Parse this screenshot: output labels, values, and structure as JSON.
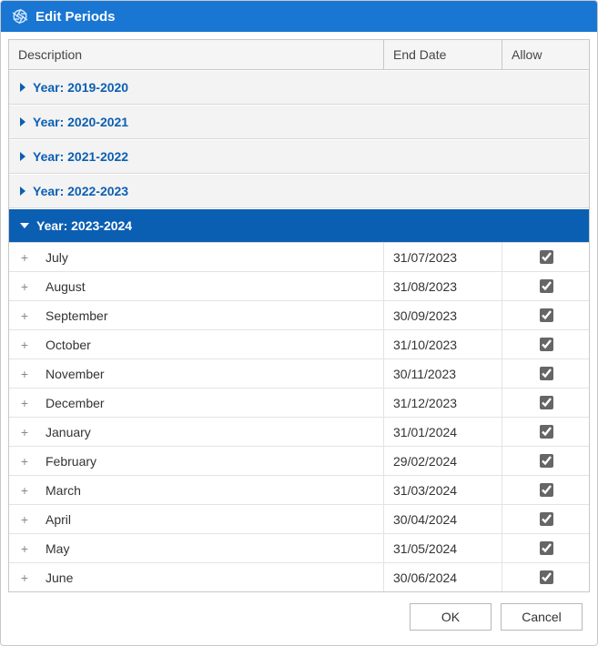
{
  "title": "Edit Periods",
  "columns": {
    "description": "Description",
    "end_date": "End Date",
    "allow": "Allow"
  },
  "groups": [
    {
      "label": "Year: 2019-2020",
      "expanded": false
    },
    {
      "label": "Year: 2020-2021",
      "expanded": false
    },
    {
      "label": "Year: 2021-2022",
      "expanded": false
    },
    {
      "label": "Year: 2022-2023",
      "expanded": false
    },
    {
      "label": "Year: 2023-2024",
      "expanded": true
    }
  ],
  "rows": [
    {
      "month": "July",
      "end_date": "31/07/2023",
      "allow": true
    },
    {
      "month": "August",
      "end_date": "31/08/2023",
      "allow": true
    },
    {
      "month": "September",
      "end_date": "30/09/2023",
      "allow": true
    },
    {
      "month": "October",
      "end_date": "31/10/2023",
      "allow": true
    },
    {
      "month": "November",
      "end_date": "30/11/2023",
      "allow": true
    },
    {
      "month": "December",
      "end_date": "31/12/2023",
      "allow": true
    },
    {
      "month": "January",
      "end_date": "31/01/2024",
      "allow": true
    },
    {
      "month": "February",
      "end_date": "29/02/2024",
      "allow": true
    },
    {
      "month": "March",
      "end_date": "31/03/2024",
      "allow": true
    },
    {
      "month": "April",
      "end_date": "30/04/2024",
      "allow": true
    },
    {
      "month": "May",
      "end_date": "31/05/2024",
      "allow": true
    },
    {
      "month": "June",
      "end_date": "30/06/2024",
      "allow": true
    }
  ],
  "buttons": {
    "ok": "OK",
    "cancel": "Cancel"
  },
  "icons": {
    "app": "aperture-icon",
    "plus": "+"
  }
}
